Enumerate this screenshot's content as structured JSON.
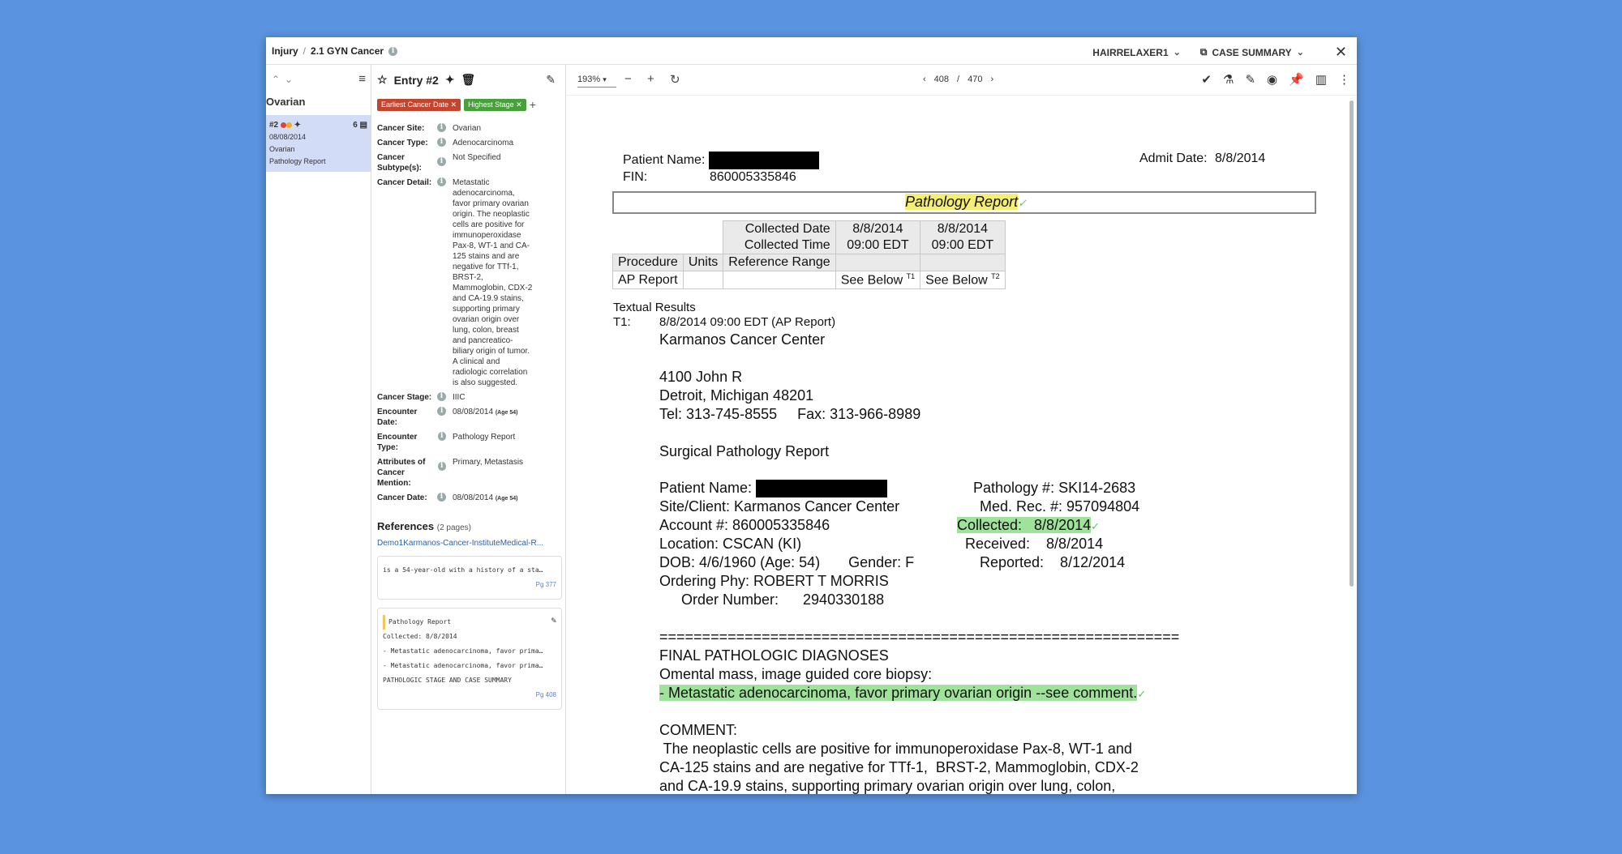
{
  "breadcrumb": {
    "root": "Injury",
    "current": "2.1 GYN Cancer"
  },
  "topbar": {
    "project": "HAIRRELAXER1",
    "view": "CASE SUMMARY"
  },
  "nav": {
    "title": "Ovarian",
    "item": {
      "id": "#2",
      "count": "6",
      "date": "08/08/2014",
      "site": "Ovarian",
      "type": "Pathology Report"
    }
  },
  "entry": {
    "title": "Entry #2",
    "tags": [
      "Earliest Cancer Date",
      "Highest Stage"
    ],
    "fields": [
      {
        "label": "Cancer Site:",
        "value": "Ovarian"
      },
      {
        "label": "Cancer Type:",
        "value": "Adenocarcinoma"
      },
      {
        "label": "Cancer Subtype(s):",
        "value": "Not Specified"
      },
      {
        "label": "Cancer Detail:",
        "value": "Metastatic\nadenocarcinoma,\nfavor primary ovarian\norigin. The neoplastic\ncells are positive for\nimmunoperoxidase\nPax-8, WT-1 and CA-\n125 stains and are\nnegative for TTf-1,\nBRST-2,\nMammoglobin, CDX-2\nand CA-19.9 stains,\nsupporting primary\novarian origin over\nlung, colon, breast\nand pancreatico-\nbiliary origin of tumor.\nA clinical and\nradiologic correlation\nis also suggested."
      },
      {
        "label": "Cancer Stage:",
        "value": "IIIC"
      },
      {
        "label": "Encounter Date:",
        "value": "08/08/2014",
        "age": "(Age 54)"
      },
      {
        "label": "Encounter Type:",
        "value": "Pathology Report"
      },
      {
        "label": "Attributes of Cancer Mention:",
        "value": "Primary, Metastasis"
      },
      {
        "label": "Cancer Date:",
        "value": "08/08/2014",
        "age": "(Age 54)"
      }
    ]
  },
  "references": {
    "title": "References",
    "count": "(2 pages)",
    "link": "Demo1Karmanos-Cancer-InstituteMedical-R...",
    "card1": {
      "text": "is a 54-year-old with a history of a sta…",
      "page": "Pg 377"
    },
    "card2": {
      "lines": [
        "Pathology Report",
        "Collected: 8/8/2014",
        "- Metastatic adenocarcinoma, favor prima…",
        "- Metastatic adenocarcinoma, favor prima…",
        "PATHOLOGIC STAGE AND CASE SUMMARY"
      ],
      "page": "Pg 408"
    }
  },
  "viewer": {
    "zoom": "193%",
    "page": "408",
    "total": "470"
  },
  "doc": {
    "patient_label": "Patient Name:",
    "fin_label": "FIN:",
    "fin": "860005335846",
    "admit_label": "Admit Date:",
    "admit": "8/8/2014",
    "report_title": "Pathology Report",
    "tbl": {
      "cd": "Collected Date",
      "ct": "Collected Time",
      "d1": "8/8/2014",
      "t1": "09:00 EDT",
      "d2": "8/8/2014",
      "t2": "09:00 EDT",
      "proc": "Procedure",
      "units": "Units",
      "range": "Reference Range",
      "ap": "AP Report",
      "sb1": "See Below",
      "sup1": "T1",
      "sb2": "See Below",
      "sup2": "T2"
    },
    "textual": "Textual Results",
    "t1": "T1:",
    "t1_line": "8/8/2014 09:00 EDT (AP Report)",
    "center": "Karmanos Cancer Center",
    "addr1": "4100 John R",
    "addr2": "Detroit, Michigan 48201",
    "tel": "Tel: 313-745-8555     Fax: 313-966-8989",
    "spr": "Surgical Pathology Report",
    "pn": "Patient Name:",
    "path": "Pathology #: SKI14-2683",
    "site": "Site/Client: Karmanos Cancer Center",
    "mrn": "Med. Rec. #: 957094804",
    "acct": "Account #: 860005335846",
    "collected": "Collected:   8/8/2014",
    "loc": "Location: CSCAN (KI)",
    "recv": "Received:    8/8/2014",
    "dob": "DOB: 4/6/1960 (Age: 54)       Gender: F",
    "rep": "Reported:    8/12/2014",
    "phy": "Ordering Phy: ROBERT T MORRIS",
    "order": "Order Number:      2940330188",
    "rule": "=============================================================",
    "fpd": "FINAL PATHOLOGIC DIAGNOSES",
    "om": "Omental mass, image guided core biopsy:",
    "dx": "- Metastatic adenocarcinoma, favor primary ovarian origin --see comment.",
    "comment": "COMMENT:",
    "c1": " The neoplastic cells are positive for immunoperoxidase Pax-8, WT-1 and",
    "c2": "CA-125 stains and are negative for TTf-1,  BRST-2, Mammoglobin, CDX-2",
    "c3": "and CA-19.9 stains, supporting primary ovarian origin over lung, colon,"
  }
}
